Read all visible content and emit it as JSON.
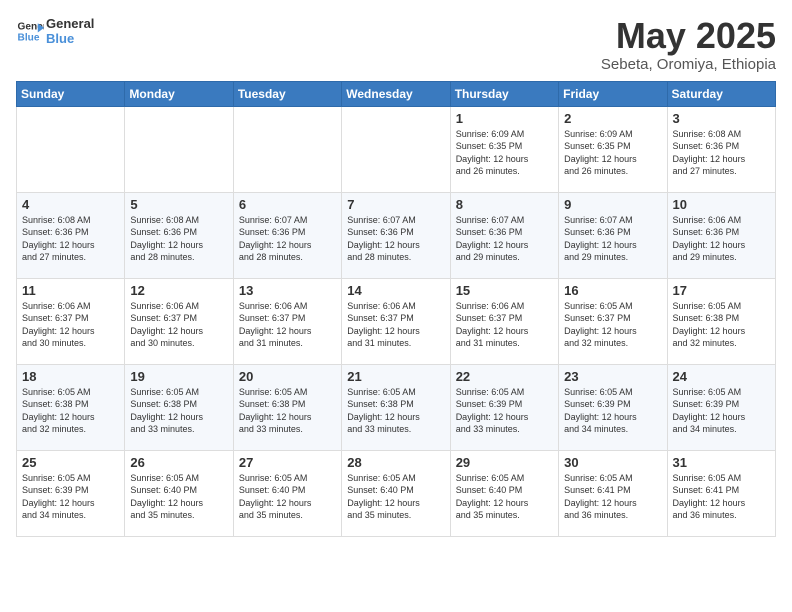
{
  "header": {
    "logo_line1": "General",
    "logo_line2": "Blue",
    "month_title": "May 2025",
    "location": "Sebeta, Oromiya, Ethiopia"
  },
  "days_of_week": [
    "Sunday",
    "Monday",
    "Tuesday",
    "Wednesday",
    "Thursday",
    "Friday",
    "Saturday"
  ],
  "weeks": [
    [
      {
        "day": "",
        "info": ""
      },
      {
        "day": "",
        "info": ""
      },
      {
        "day": "",
        "info": ""
      },
      {
        "day": "",
        "info": ""
      },
      {
        "day": "1",
        "info": "Sunrise: 6:09 AM\nSunset: 6:35 PM\nDaylight: 12 hours\nand 26 minutes."
      },
      {
        "day": "2",
        "info": "Sunrise: 6:09 AM\nSunset: 6:35 PM\nDaylight: 12 hours\nand 26 minutes."
      },
      {
        "day": "3",
        "info": "Sunrise: 6:08 AM\nSunset: 6:36 PM\nDaylight: 12 hours\nand 27 minutes."
      }
    ],
    [
      {
        "day": "4",
        "info": "Sunrise: 6:08 AM\nSunset: 6:36 PM\nDaylight: 12 hours\nand 27 minutes."
      },
      {
        "day": "5",
        "info": "Sunrise: 6:08 AM\nSunset: 6:36 PM\nDaylight: 12 hours\nand 28 minutes."
      },
      {
        "day": "6",
        "info": "Sunrise: 6:07 AM\nSunset: 6:36 PM\nDaylight: 12 hours\nand 28 minutes."
      },
      {
        "day": "7",
        "info": "Sunrise: 6:07 AM\nSunset: 6:36 PM\nDaylight: 12 hours\nand 28 minutes."
      },
      {
        "day": "8",
        "info": "Sunrise: 6:07 AM\nSunset: 6:36 PM\nDaylight: 12 hours\nand 29 minutes."
      },
      {
        "day": "9",
        "info": "Sunrise: 6:07 AM\nSunset: 6:36 PM\nDaylight: 12 hours\nand 29 minutes."
      },
      {
        "day": "10",
        "info": "Sunrise: 6:06 AM\nSunset: 6:36 PM\nDaylight: 12 hours\nand 29 minutes."
      }
    ],
    [
      {
        "day": "11",
        "info": "Sunrise: 6:06 AM\nSunset: 6:37 PM\nDaylight: 12 hours\nand 30 minutes."
      },
      {
        "day": "12",
        "info": "Sunrise: 6:06 AM\nSunset: 6:37 PM\nDaylight: 12 hours\nand 30 minutes."
      },
      {
        "day": "13",
        "info": "Sunrise: 6:06 AM\nSunset: 6:37 PM\nDaylight: 12 hours\nand 31 minutes."
      },
      {
        "day": "14",
        "info": "Sunrise: 6:06 AM\nSunset: 6:37 PM\nDaylight: 12 hours\nand 31 minutes."
      },
      {
        "day": "15",
        "info": "Sunrise: 6:06 AM\nSunset: 6:37 PM\nDaylight: 12 hours\nand 31 minutes."
      },
      {
        "day": "16",
        "info": "Sunrise: 6:05 AM\nSunset: 6:37 PM\nDaylight: 12 hours\nand 32 minutes."
      },
      {
        "day": "17",
        "info": "Sunrise: 6:05 AM\nSunset: 6:38 PM\nDaylight: 12 hours\nand 32 minutes."
      }
    ],
    [
      {
        "day": "18",
        "info": "Sunrise: 6:05 AM\nSunset: 6:38 PM\nDaylight: 12 hours\nand 32 minutes."
      },
      {
        "day": "19",
        "info": "Sunrise: 6:05 AM\nSunset: 6:38 PM\nDaylight: 12 hours\nand 33 minutes."
      },
      {
        "day": "20",
        "info": "Sunrise: 6:05 AM\nSunset: 6:38 PM\nDaylight: 12 hours\nand 33 minutes."
      },
      {
        "day": "21",
        "info": "Sunrise: 6:05 AM\nSunset: 6:38 PM\nDaylight: 12 hours\nand 33 minutes."
      },
      {
        "day": "22",
        "info": "Sunrise: 6:05 AM\nSunset: 6:39 PM\nDaylight: 12 hours\nand 33 minutes."
      },
      {
        "day": "23",
        "info": "Sunrise: 6:05 AM\nSunset: 6:39 PM\nDaylight: 12 hours\nand 34 minutes."
      },
      {
        "day": "24",
        "info": "Sunrise: 6:05 AM\nSunset: 6:39 PM\nDaylight: 12 hours\nand 34 minutes."
      }
    ],
    [
      {
        "day": "25",
        "info": "Sunrise: 6:05 AM\nSunset: 6:39 PM\nDaylight: 12 hours\nand 34 minutes."
      },
      {
        "day": "26",
        "info": "Sunrise: 6:05 AM\nSunset: 6:40 PM\nDaylight: 12 hours\nand 35 minutes."
      },
      {
        "day": "27",
        "info": "Sunrise: 6:05 AM\nSunset: 6:40 PM\nDaylight: 12 hours\nand 35 minutes."
      },
      {
        "day": "28",
        "info": "Sunrise: 6:05 AM\nSunset: 6:40 PM\nDaylight: 12 hours\nand 35 minutes."
      },
      {
        "day": "29",
        "info": "Sunrise: 6:05 AM\nSunset: 6:40 PM\nDaylight: 12 hours\nand 35 minutes."
      },
      {
        "day": "30",
        "info": "Sunrise: 6:05 AM\nSunset: 6:41 PM\nDaylight: 12 hours\nand 36 minutes."
      },
      {
        "day": "31",
        "info": "Sunrise: 6:05 AM\nSunset: 6:41 PM\nDaylight: 12 hours\nand 36 minutes."
      }
    ]
  ]
}
